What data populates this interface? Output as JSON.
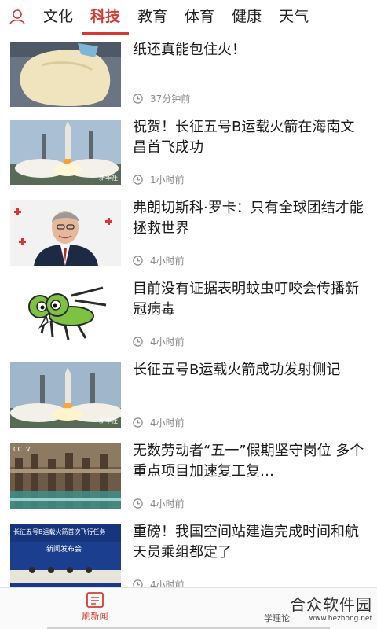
{
  "header": {
    "tabs": [
      "文化",
      "科技",
      "教育",
      "体育",
      "健康",
      "天气"
    ],
    "active_tab": "科技",
    "accent_color": "#d43c33"
  },
  "news": [
    {
      "title": "纸还真能包住火！",
      "time": "37分钟前"
    },
    {
      "title": "祝贺！长征五号B运载火箭在海南文昌首飞成功",
      "time": "1小时前"
    },
    {
      "title": "弗朗切斯科·罗卡：只有全球团结才能拯救世界",
      "time": "4小时前"
    },
    {
      "title": "目前没有证据表明蚊虫叮咬会传播新冠病毒",
      "time": "4小时前"
    },
    {
      "title": "长征五号B运载火箭成功发射侧记",
      "time": "4小时前"
    },
    {
      "title": "无数劳动者“五一”假期坚守岗位 多个重点项目加速复工复…",
      "time": "4小时前"
    },
    {
      "title": "重磅！我国空间站建造完成时间和航天员乘组都定了",
      "time": "4小时前"
    }
  ],
  "thumbs": {
    "t2_caption": "新华社",
    "t4_caption": "",
    "t5_caption": "新华社",
    "t6_caption": "CCTV",
    "t7_banner": "长征五号B运载火箭首次飞行任务",
    "t7_sub": "新闻发布会"
  },
  "bottom_nav": {
    "home_label": "刷新闻",
    "study_label": "学理论"
  },
  "watermark": {
    "main": "合众软件园",
    "url": "www.hezhong.net"
  }
}
